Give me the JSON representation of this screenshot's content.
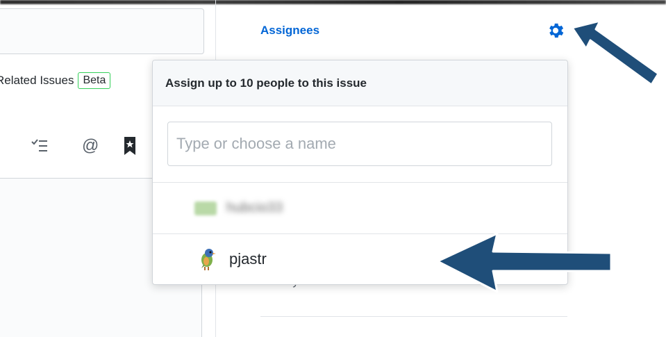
{
  "editor": {
    "related_label": "Related Issues",
    "beta_badge": "Beta"
  },
  "toolbar": {
    "icons": [
      "task-list-icon",
      "mention-icon",
      "bookmark-icon"
    ],
    "mention_glyph": "@"
  },
  "sidebar": {
    "assignees_label": "Assignees",
    "assignees_value": "None yet"
  },
  "popover": {
    "header": "Assign up to 10 people to this issue",
    "filter_placeholder": "Type or choose a name",
    "users": [
      {
        "name": "hubcio33",
        "blurred": true
      },
      {
        "name": "pjastr",
        "blurred": false
      }
    ]
  },
  "colors": {
    "link": "#0366d6",
    "arrow_fill": "#1f4e79",
    "beta_border": "#34d058"
  }
}
